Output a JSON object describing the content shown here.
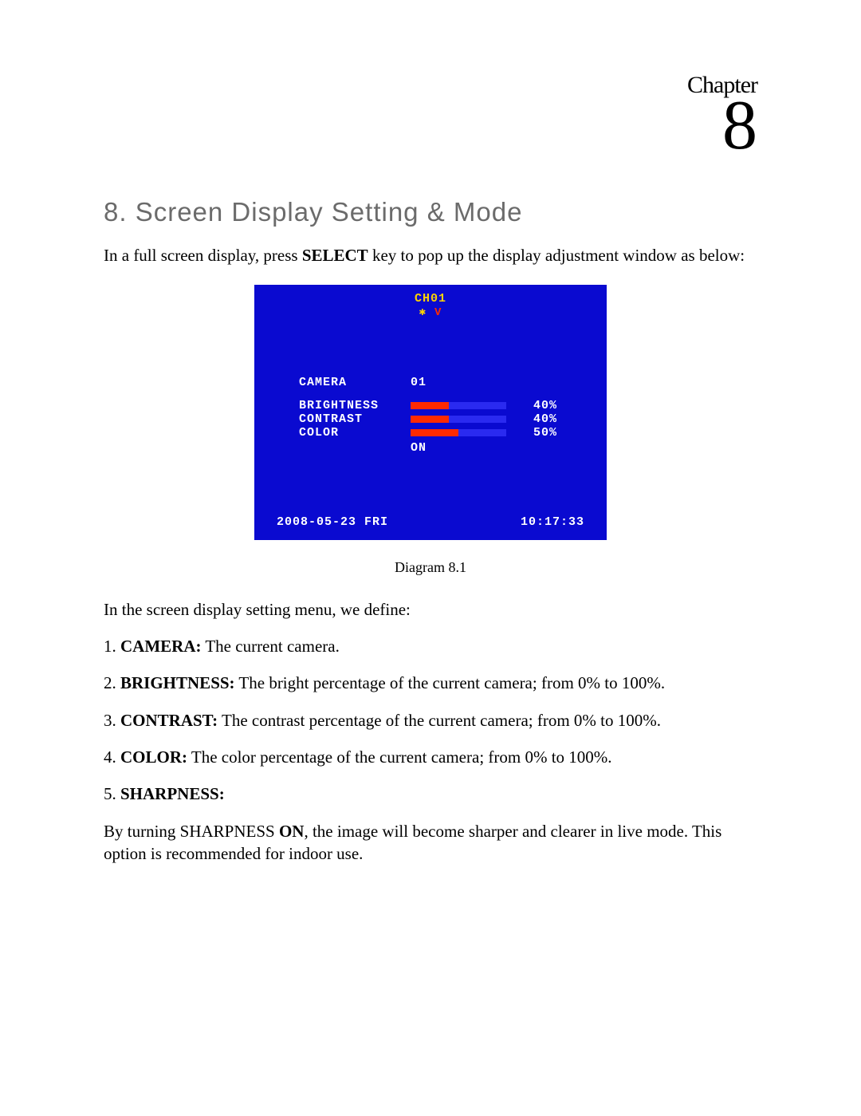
{
  "chapter": {
    "label": "Chapter",
    "number": "8"
  },
  "heading": "8. Screen Display Setting & Mode",
  "intro": {
    "pre": "In a full screen display, press ",
    "key": "SELECT",
    "post": " key to pop up the display adjustment window as below:"
  },
  "osd": {
    "channel": "CH01",
    "icons": {
      "star": "✱",
      "v": "V"
    },
    "camera_label": "CAMERA",
    "camera_value": "01",
    "rows": [
      {
        "label": "BRIGHTNESS",
        "pct": 40,
        "pct_text": "40%"
      },
      {
        "label": "CONTRAST",
        "pct": 40,
        "pct_text": "40%"
      },
      {
        "label": "COLOR",
        "pct": 50,
        "pct_text": "50%"
      }
    ],
    "on_label": "ON",
    "date": "2008-05-23 FRI",
    "time": "10:17:33"
  },
  "diagram_caption": "Diagram 8.1",
  "defs_intro": "In the screen display setting menu, we define:",
  "defs": [
    {
      "n": "1.",
      "term": "CAMERA:",
      "desc": " The current camera."
    },
    {
      "n": "2.",
      "term": "BRIGHTNESS:",
      "desc": " The bright percentage of the current camera; from 0% to 100%."
    },
    {
      "n": "3.",
      "term": "CONTRAST:",
      "desc": " The contrast percentage of the current camera; from 0% to 100%."
    },
    {
      "n": "4.",
      "term": "COLOR:",
      "desc": " The color percentage of the current camera; from 0% to 100%."
    },
    {
      "n": "5.",
      "term": "SHARPNESS:",
      "desc": ""
    }
  ],
  "sharpness_note": {
    "pre": "By turning SHARPNESS ",
    "key": "ON",
    "post": ", the image will become sharper and clearer in live mode. This option is recommended for indoor use."
  }
}
